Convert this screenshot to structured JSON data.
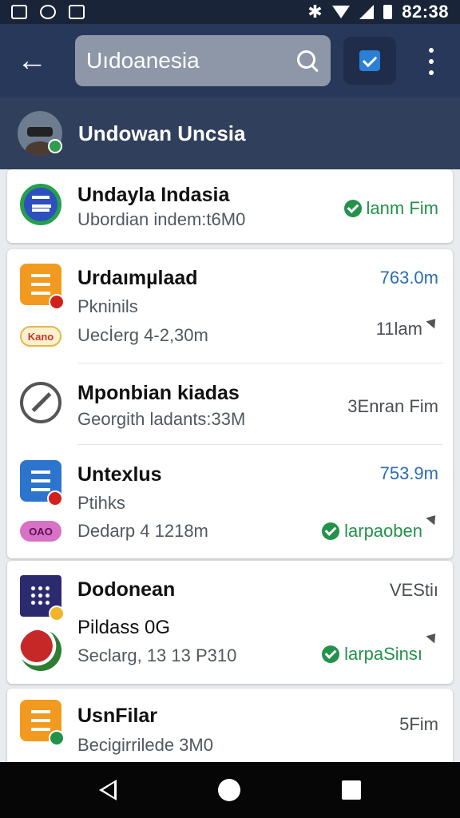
{
  "status_bar": {
    "time": "82:38"
  },
  "toolbar": {
    "search_value": "Uıdoanesia"
  },
  "account": {
    "name": "Undowan Uncsia"
  },
  "items": [
    {
      "title": "Undayla Indasia",
      "subtitle": "Ubordian indem:t6M0",
      "status": "lanm Fim",
      "status_color": "#23924a"
    },
    {
      "title": "Urdaımµlaad",
      "line2": "Pkninils",
      "line3": "Uecİerg 4-2,30m",
      "chip": "Kano",
      "value": "763.0m",
      "value2": "11lam"
    },
    {
      "title": "Mponbian kiadas",
      "subtitle": "Georgith ladants:33M",
      "status": "3Enran Fim"
    },
    {
      "title": "Untexlus",
      "line2": "Ptihks",
      "line3": "Dedarp 4 1218m",
      "chip": "OAO",
      "value": "753.9m",
      "status": "larpaoben"
    },
    {
      "title": "Dodonean",
      "line2": "Pildass 0G",
      "line3": "Seclarg, 13 13 P310",
      "value": "VEStiı",
      "status": "larpaSinsı"
    },
    {
      "title": "UsnFilar",
      "line2": "Becigirrilede 3M0",
      "value": "5Fim"
    }
  ],
  "colors": {
    "status_bar": "#1a2438",
    "toolbar": "#27385a",
    "account_bar": "#2f3f5c",
    "accent_blue": "#2a6db3",
    "accent_green": "#23924a"
  }
}
